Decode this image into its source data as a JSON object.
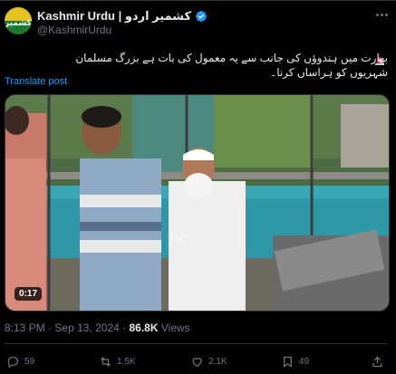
{
  "account": {
    "display_name": "Kashmir Urdu | کشمیر اردو",
    "handle": "@KashmirUrdu",
    "avatar_text": "کشمیر"
  },
  "post": {
    "text": "بھارت میں ہندوؤں کی جانب سے یہ معمول کی بات ہے بزرگ مسلمان شہریوں کو ہراساں کرنا۔",
    "translate_label": "Translate post",
    "video_duration": "0:17",
    "overlay_text": "TNT"
  },
  "meta": {
    "time": "8:13 PM",
    "separator": "·",
    "date": "Sep 13, 2024",
    "views": "86.8K",
    "views_label": "Views"
  },
  "actions": {
    "replies": "59",
    "reposts": "1.5K",
    "likes": "2.1K",
    "bookmarks": "49"
  },
  "colors": {
    "background": "#000000",
    "text": "#e7e9ea",
    "muted": "#71767b",
    "accent": "#1d9bf0"
  }
}
